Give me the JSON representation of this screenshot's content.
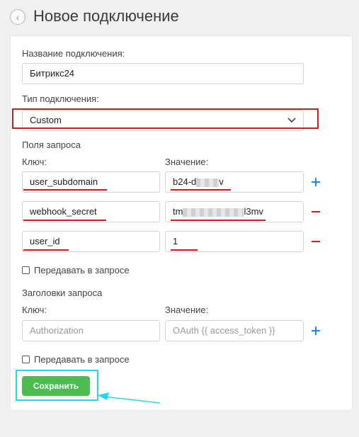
{
  "header": {
    "title": "Новое подключение",
    "back_icon": "chevron-left-icon"
  },
  "form": {
    "name_label": "Название подключения:",
    "name_value": "Битрикс24",
    "type_label": "Тип подключения:",
    "type_value": "Custom",
    "request_fields_label": "Поля запроса",
    "key_label": "Ключ:",
    "value_label": "Значение:",
    "fields": [
      {
        "key": "user_subdomain",
        "value_prefix": "b24-d",
        "value_suffix": "v"
      },
      {
        "key": "webhook_secret",
        "value_prefix": "tm",
        "value_suffix": "l3mv"
      },
      {
        "key": "user_id",
        "value_prefix": "1",
        "value_suffix": ""
      }
    ],
    "send_in_request_1": "Передавать в запросе",
    "headers_label": "Заголовки запроса",
    "headers_key_label": "Ключ:",
    "headers_value_label": "Значение:",
    "header_key_placeholder": "Authorization",
    "header_value_placeholder": "OAuth {{ access_token }}",
    "send_in_request_2": "Передавать в запросе",
    "save_label": "Сохранить"
  },
  "colors": {
    "accent_green": "#4cbb50",
    "plus_blue": "#1e88e5",
    "minus_red": "#d71920",
    "annotation_red": "#d71920",
    "annotation_cyan": "#27d6e8"
  }
}
